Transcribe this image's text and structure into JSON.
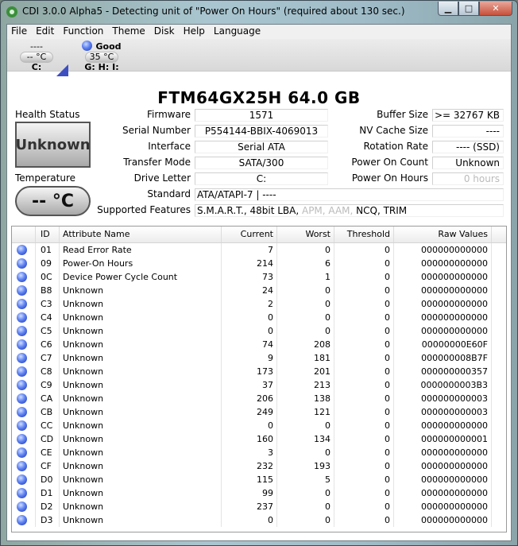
{
  "window": {
    "title": "CDI 3.0.0 Alpha5 - Detecting unit of \"Power On Hours\" (required about 130 sec.)"
  },
  "caption_buttons": {
    "minimize": "▁",
    "maximize": "□",
    "close": "✕"
  },
  "menu": [
    "File",
    "Edit",
    "Function",
    "Theme",
    "Disk",
    "Help",
    "Language"
  ],
  "drives": [
    {
      "state": "----",
      "temp": "-- °C",
      "letter": "C:"
    },
    {
      "state": "Good",
      "temp": "35 °C",
      "letter": "G: H: I:"
    }
  ],
  "model": "FTM64GX25H  64.0 GB",
  "health": {
    "title": "Health Status",
    "value": "Unknown"
  },
  "temperature": {
    "title": "Temperature",
    "value": "-- °C"
  },
  "info_left": [
    {
      "label": "Firmware",
      "value": "1571"
    },
    {
      "label": "Serial Number",
      "value": "P554144-BBIX-4069013"
    },
    {
      "label": "Interface",
      "value": "Serial ATA"
    },
    {
      "label": "Transfer Mode",
      "value": "SATA/300"
    },
    {
      "label": "Drive Letter",
      "value": "C:"
    }
  ],
  "info_right": [
    {
      "label": "Buffer Size",
      "value": ">= 32767 KB"
    },
    {
      "label": "NV Cache Size",
      "value": "----"
    },
    {
      "label": "Rotation Rate",
      "value": "---- (SSD)"
    },
    {
      "label": "Power On Count",
      "value": "Unknown"
    },
    {
      "label": "Power On Hours",
      "value": "0 hours"
    }
  ],
  "standard": {
    "label": "Standard",
    "value": "ATA/ATAPI-7 | ----"
  },
  "features": {
    "label": "Supported Features",
    "active1": "S.M.A.R.T., 48bit LBA, ",
    "inactive1": "APM, AAM, ",
    "active2": "NCQ, TRIM"
  },
  "table": {
    "headers": {
      "id": "ID",
      "name": "Attribute Name",
      "current": "Current",
      "worst": "Worst",
      "threshold": "Threshold",
      "raw": "Raw Values"
    },
    "rows": [
      {
        "id": "01",
        "name": "Read Error Rate",
        "current": "7",
        "worst": "0",
        "threshold": "0",
        "raw": "000000000000"
      },
      {
        "id": "09",
        "name": "Power-On Hours",
        "current": "214",
        "worst": "6",
        "threshold": "0",
        "raw": "000000000000"
      },
      {
        "id": "0C",
        "name": "Device Power Cycle Count",
        "current": "73",
        "worst": "1",
        "threshold": "0",
        "raw": "000000000000"
      },
      {
        "id": "B8",
        "name": "Unknown",
        "current": "24",
        "worst": "0",
        "threshold": "0",
        "raw": "000000000000"
      },
      {
        "id": "C3",
        "name": "Unknown",
        "current": "2",
        "worst": "0",
        "threshold": "0",
        "raw": "000000000000"
      },
      {
        "id": "C4",
        "name": "Unknown",
        "current": "0",
        "worst": "0",
        "threshold": "0",
        "raw": "000000000000"
      },
      {
        "id": "C5",
        "name": "Unknown",
        "current": "0",
        "worst": "0",
        "threshold": "0",
        "raw": "000000000000"
      },
      {
        "id": "C6",
        "name": "Unknown",
        "current": "74",
        "worst": "208",
        "threshold": "0",
        "raw": "00000000E60F"
      },
      {
        "id": "C7",
        "name": "Unknown",
        "current": "9",
        "worst": "181",
        "threshold": "0",
        "raw": "000000008B7F"
      },
      {
        "id": "C8",
        "name": "Unknown",
        "current": "173",
        "worst": "201",
        "threshold": "0",
        "raw": "000000000357"
      },
      {
        "id": "C9",
        "name": "Unknown",
        "current": "37",
        "worst": "213",
        "threshold": "0",
        "raw": "0000000003B3"
      },
      {
        "id": "CA",
        "name": "Unknown",
        "current": "206",
        "worst": "138",
        "threshold": "0",
        "raw": "000000000003"
      },
      {
        "id": "CB",
        "name": "Unknown",
        "current": "249",
        "worst": "121",
        "threshold": "0",
        "raw": "000000000003"
      },
      {
        "id": "CC",
        "name": "Unknown",
        "current": "0",
        "worst": "0",
        "threshold": "0",
        "raw": "000000000000"
      },
      {
        "id": "CD",
        "name": "Unknown",
        "current": "160",
        "worst": "134",
        "threshold": "0",
        "raw": "000000000001"
      },
      {
        "id": "CE",
        "name": "Unknown",
        "current": "3",
        "worst": "0",
        "threshold": "0",
        "raw": "000000000000"
      },
      {
        "id": "CF",
        "name": "Unknown",
        "current": "232",
        "worst": "193",
        "threshold": "0",
        "raw": "000000000000"
      },
      {
        "id": "D0",
        "name": "Unknown",
        "current": "115",
        "worst": "5",
        "threshold": "0",
        "raw": "000000000000"
      },
      {
        "id": "D1",
        "name": "Unknown",
        "current": "99",
        "worst": "0",
        "threshold": "0",
        "raw": "000000000000"
      },
      {
        "id": "D2",
        "name": "Unknown",
        "current": "237",
        "worst": "0",
        "threshold": "0",
        "raw": "000000000000"
      },
      {
        "id": "D3",
        "name": "Unknown",
        "current": "0",
        "worst": "0",
        "threshold": "0",
        "raw": "000000000000"
      }
    ]
  }
}
